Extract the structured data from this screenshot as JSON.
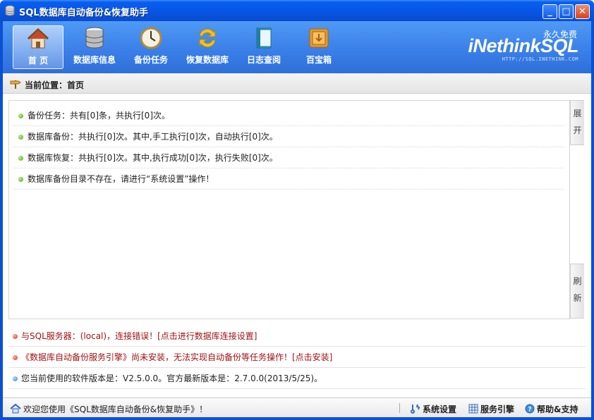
{
  "window": {
    "title": "SQL数据库自动备份&恢复助手",
    "controls": {
      "minimize": "_",
      "maximize": "□",
      "close": "✕"
    }
  },
  "toolbar": {
    "items": [
      {
        "label": "首 页",
        "icon": "home-icon",
        "active": true
      },
      {
        "label": "数据库信息",
        "icon": "database-icon",
        "active": false
      },
      {
        "label": "备份任务",
        "icon": "clock-icon",
        "active": false
      },
      {
        "label": "恢复数据库",
        "icon": "refresh-icon",
        "active": false
      },
      {
        "label": "日志查阅",
        "icon": "book-icon",
        "active": false
      },
      {
        "label": "百宝箱",
        "icon": "toolbox-icon",
        "active": false
      }
    ],
    "brand": "iNethinkSQL",
    "brand_tagline": "永久免费",
    "brand_url": "HTTP://SQL.INETHINK.COM"
  },
  "breadcrumb": {
    "text": "当前位置：首页"
  },
  "panel": {
    "messages": [
      "备份任务：共有[0]条，共执行[0]次。",
      "数据库备份：共执行[0]次。其中,手工执行[0]次，自动执行[0]次。",
      "数据库恢复：共执行[0]次。其中,执行成功[0]次，执行失败[0]次。",
      "数据库备份目录不存在，请进行“系统设置”操作！"
    ],
    "side_expand": [
      "展",
      "开"
    ],
    "side_refresh": [
      "刷",
      "新"
    ]
  },
  "status_messages": [
    {
      "text": "与SQL服务器：(local)，连接错误！[点击进行数据库连接设置]",
      "type": "error"
    },
    {
      "text": "《数据库自动备份服务引擎》尚未安装，无法实现自动备份等任务操作！[点击安装]",
      "type": "error"
    },
    {
      "text": "您当前使用的软件版本是：V2.5.0.0。官方最新版本是：2.7.0.0(2013/5/25)。",
      "type": "info"
    }
  ],
  "footer": {
    "welcome": "欢迎您使用《SQL数据库自动备份&恢复助手》！",
    "settings": "系统设置",
    "service": "服务引擎",
    "help": "帮助&支持"
  },
  "colors": {
    "titlebar": "#0756e2",
    "toolbar": "#3a80e8",
    "error": "#a11212"
  }
}
